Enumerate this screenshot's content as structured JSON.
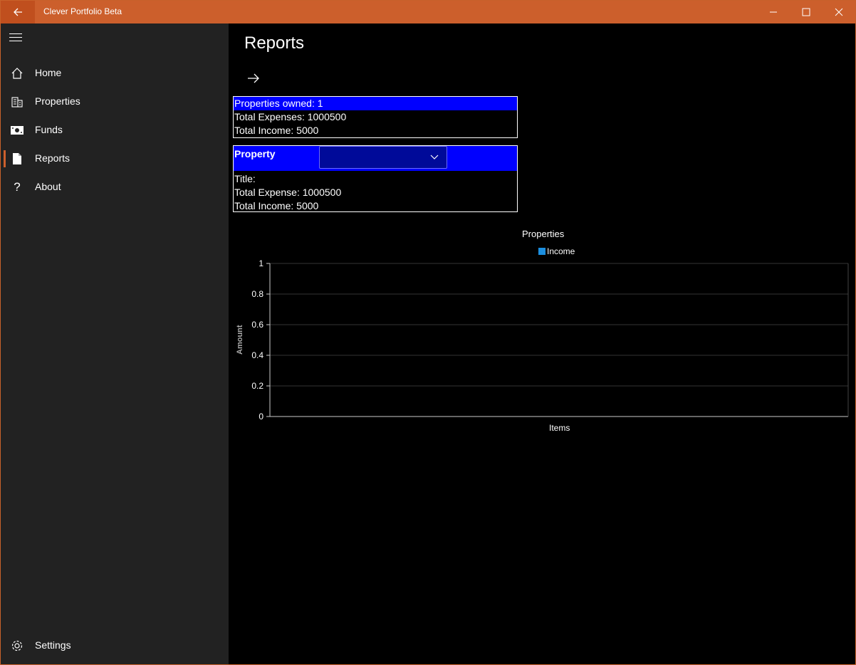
{
  "app": {
    "title": "Clever Portfolio Beta"
  },
  "nav": {
    "items": [
      {
        "label": "Home",
        "icon": "home-icon"
      },
      {
        "label": "Properties",
        "icon": "building-icon"
      },
      {
        "label": "Funds",
        "icon": "money-icon"
      },
      {
        "label": "Reports",
        "icon": "document-icon",
        "active": true
      },
      {
        "label": "About",
        "icon": "question-icon"
      }
    ],
    "settings": {
      "label": "Settings",
      "icon": "gear-icon"
    }
  },
  "page": {
    "title": "Reports"
  },
  "summary": {
    "owned": "Properties owned: 1",
    "expenses": "Total Expenses: 1000500",
    "income": "Total Income: 5000"
  },
  "property": {
    "header": "Property",
    "selected": "",
    "title": "Title:",
    "expense": "Total Expense: 1000500",
    "income": "Total Income: 5000"
  },
  "colors": {
    "accent": "#cc5f2c",
    "highlight": "#0000ff",
    "series": "#1c8fe0"
  },
  "chart_data": {
    "type": "bar",
    "title": "Properties",
    "xlabel": "Items",
    "ylabel": "Amount",
    "ylim": [
      0,
      1
    ],
    "yticks": [
      "0",
      "0.2",
      "0.4",
      "0.6",
      "0.8",
      "1"
    ],
    "categories": [],
    "series": [
      {
        "name": "Income",
        "values": []
      }
    ],
    "legend": "top-center",
    "grid": true
  }
}
